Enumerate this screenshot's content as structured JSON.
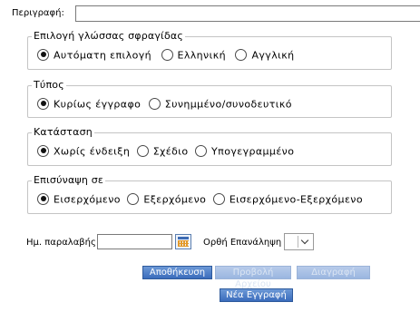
{
  "description": {
    "label": "Περιγραφή:",
    "value": "",
    "placeholder": ""
  },
  "groups": [
    {
      "legend": "Επιλογή γλώσσας σφραγίδας",
      "options": [
        {
          "label": "Αυτόματη επιλογή",
          "checked": true
        },
        {
          "label": "Ελληνική",
          "checked": false
        },
        {
          "label": "Αγγλική",
          "checked": false
        }
      ]
    },
    {
      "legend": "Τύπος",
      "options": [
        {
          "label": "Κυρίως έγγραφο",
          "checked": true
        },
        {
          "label": "Συνημμένο/συνοδευτικό",
          "checked": false
        }
      ]
    },
    {
      "legend": "Κατάσταση",
      "options": [
        {
          "label": "Χωρίς ένδειξη",
          "checked": true
        },
        {
          "label": "Σχέδιο",
          "checked": false
        },
        {
          "label": "Υπογεγραμμένο",
          "checked": false
        }
      ]
    },
    {
      "legend": "Επισύναψη σε",
      "options": [
        {
          "label": "Εισερχόμενο",
          "checked": true
        },
        {
          "label": "Εξερχόμενο",
          "checked": false
        },
        {
          "label": "Εισερχόμενο-Εξερχόμενο",
          "checked": false
        }
      ]
    }
  ],
  "received_date": {
    "label": "Ημ. παραλαβής",
    "value": "",
    "icon": "calendar-icon"
  },
  "repeat": {
    "label": "Ορθή Επανάληψη",
    "selected": "",
    "icon": "chevron-down-icon"
  },
  "buttons": {
    "save": "Αποθήκευση",
    "view_file": "Προβολή Αρχείου",
    "delete": "Διαγραφή",
    "new_entry": "Νέα Εγγραφή"
  },
  "colors": {
    "button_active": "#3a6cbc",
    "button_disabled": "#9ab6e0",
    "group_border": "#c4c4c4"
  }
}
